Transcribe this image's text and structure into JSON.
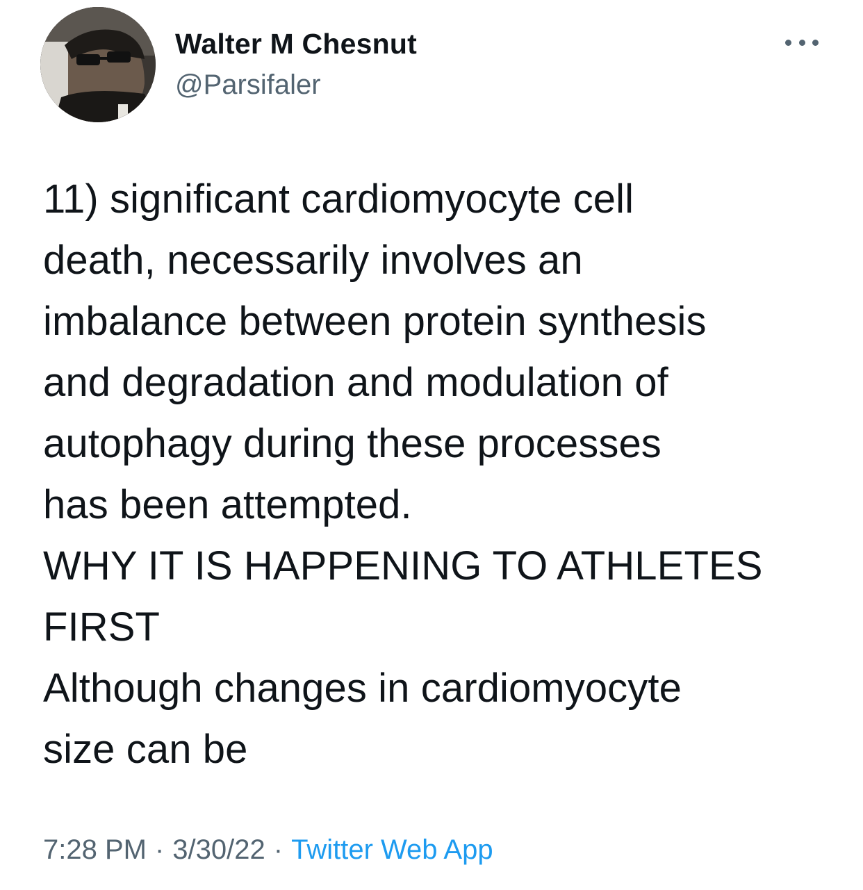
{
  "author": {
    "display_name": "Walter M Chesnut",
    "handle": "@Parsifaler",
    "avatar": "profile-photo"
  },
  "more_icon": "more-horizontal-icon",
  "tweet": {
    "lines": [
      "11) significant cardiomyocyte cell",
      "death, necessarily involves an",
      "imbalance between protein synthesis",
      "and degradation and modulation of",
      "autophagy during these processes",
      "has been attempted.",
      "WHY IT IS HAPPENING TO ATHLETES",
      "FIRST",
      "Although changes in cardiomyocyte",
      "size can be"
    ]
  },
  "meta": {
    "time": "7:28 PM",
    "separator": "·",
    "date": "3/30/22",
    "source": "Twitter Web App"
  },
  "colors": {
    "text": "#0f1419",
    "secondary": "#536471",
    "link": "#1d9bf0",
    "background": "#ffffff"
  }
}
